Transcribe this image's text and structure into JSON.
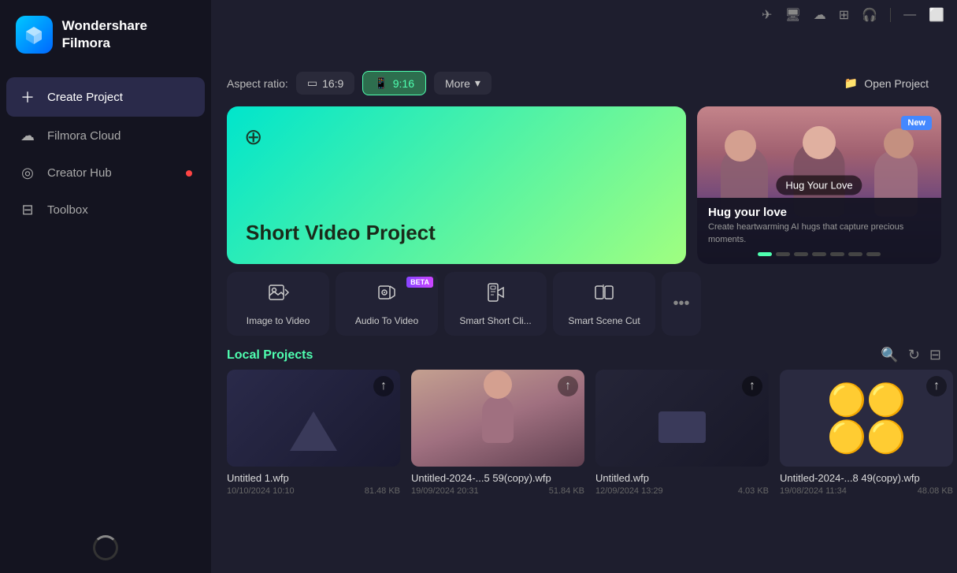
{
  "app": {
    "name": "Wondershare Filmora"
  },
  "sidebar": {
    "items": [
      {
        "id": "create-project",
        "label": "Create Project",
        "icon": "➕",
        "active": true
      },
      {
        "id": "filmora-cloud",
        "label": "Filmora Cloud",
        "icon": "☁"
      },
      {
        "id": "creator-hub",
        "label": "Creator Hub",
        "icon": "◎",
        "dot": true
      },
      {
        "id": "toolbox",
        "label": "Toolbox",
        "icon": "🧰"
      }
    ]
  },
  "aspect_ratio": {
    "label": "Aspect ratio:",
    "options": [
      {
        "id": "16-9",
        "label": "16:9",
        "active": false
      },
      {
        "id": "9-16",
        "label": "9:16",
        "active": true
      }
    ],
    "more_label": "More",
    "open_project_label": "Open Project"
  },
  "short_video": {
    "title": "Short Video Project"
  },
  "hug_card": {
    "title": "Hug your love",
    "description": "Create heartwarming AI hugs that capture precious moments.",
    "badge": "New",
    "overlay_label": "Hug Your Love"
  },
  "carousel_dots": {
    "total": 7,
    "active": 0
  },
  "tools": [
    {
      "id": "image-to-video",
      "label": "Image to Video",
      "icon": "🎬",
      "beta": false
    },
    {
      "id": "audio-to-video",
      "label": "Audio To Video",
      "icon": "🎵",
      "beta": true
    },
    {
      "id": "smart-short-clip",
      "label": "Smart Short Cli...",
      "icon": "📱",
      "beta": false
    },
    {
      "id": "smart-scene-cut",
      "label": "Smart Scene Cut",
      "icon": "✂",
      "beta": false
    }
  ],
  "more_tools": "•••",
  "local_projects": {
    "title": "Local Projects",
    "items": [
      {
        "name": "Untitled 1.wfp",
        "date": "10/10/2024 10:10",
        "size": "81.48 KB",
        "thumb": "dark"
      },
      {
        "name": "Untitled-2024-...5 59(copy).wfp",
        "date": "19/09/2024 20:31",
        "size": "51.84 KB",
        "thumb": "person"
      },
      {
        "name": "Untitled.wfp",
        "date": "12/09/2024 13:29",
        "size": "4.03 KB",
        "thumb": "dark2"
      },
      {
        "name": "Untitled-2024-...8 49(copy).wfp",
        "date": "19/08/2024 11:34",
        "size": "48.08 KB",
        "thumb": "emoji"
      }
    ]
  },
  "topbar_icons": [
    "✈",
    "💻",
    "☁",
    "⊞",
    "🎧",
    "—",
    "⬜"
  ]
}
